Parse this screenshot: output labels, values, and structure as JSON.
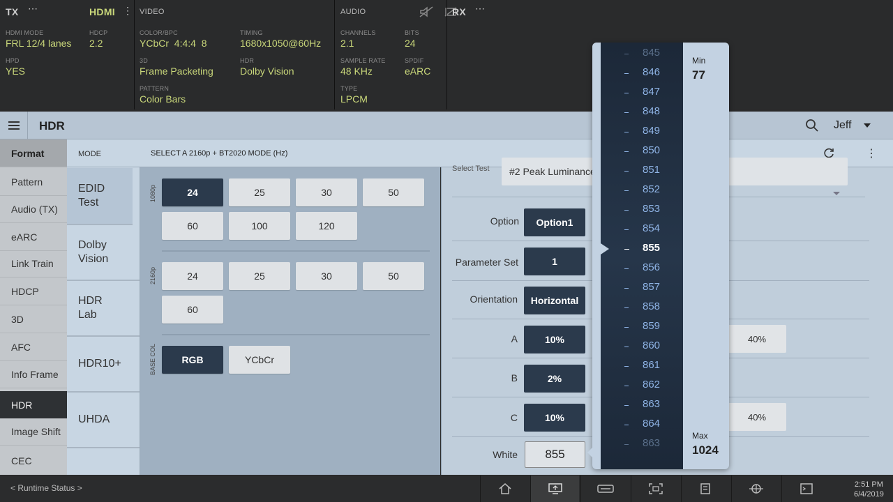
{
  "status": {
    "tx": {
      "title": "TX",
      "mode": "HDMI"
    },
    "video_title": "VIDEO",
    "audio_title": "AUDIO",
    "rx_title": "RX",
    "fields": {
      "hdmi_mode": {
        "label": "HDMI MODE",
        "value": "FRL 12/4 lanes"
      },
      "hdcp": {
        "label": "HDCP",
        "value": "2.2"
      },
      "hpd": {
        "label": "HPD",
        "value": "YES"
      },
      "color_bpc": {
        "label": "COLOR/BPC",
        "value": "YCbCr  4:4:4  8"
      },
      "timing": {
        "label": "TIMING",
        "value": "1680x1050@60Hz"
      },
      "threed": {
        "label": "3D",
        "value": "Frame Packeting"
      },
      "hdr": {
        "label": "HDR",
        "value": "Dolby Vision"
      },
      "pattern": {
        "label": "PATTERN",
        "value": "Color Bars"
      },
      "channels": {
        "label": "CHANNELS",
        "value": "2.1"
      },
      "bits": {
        "label": "BITS",
        "value": "24"
      },
      "sample_rate": {
        "label": "SAMPLE RATE",
        "value": "48 KHz"
      },
      "spdif": {
        "label": "SPDIF",
        "value": "eARC"
      },
      "type": {
        "label": "TYPE",
        "value": "LPCM"
      }
    }
  },
  "header": {
    "title": "HDR",
    "user": "Jeff"
  },
  "sidenav": [
    "Format",
    "Pattern",
    "Audio (TX)",
    "eARC",
    "Link Train",
    "HDCP",
    "3D",
    "AFC",
    "Info Frame",
    "HDR",
    "Image Shift",
    "CEC"
  ],
  "mode": {
    "header": "MODE",
    "items": [
      "EDID Test",
      "Dolby Vision",
      "HDR Lab",
      "HDR10+",
      "UHDA"
    ]
  },
  "middle": {
    "header": "SELECT A 2160p + BT2020 MODE (Hz)",
    "row1080_label": "1080p",
    "row2160_label": "2160p",
    "base_label": "BASE COL",
    "r1080": [
      "24",
      "25",
      "30",
      "50",
      "60",
      "100",
      "120"
    ],
    "r2160": [
      "24",
      "25",
      "30",
      "50",
      "60"
    ],
    "base": [
      "RGB",
      "YCbCr"
    ]
  },
  "right": {
    "select_test_label": "Select Test",
    "select_test_value": "#2 Peak Luminance",
    "option_label": "Option",
    "option_value": "Option1",
    "param_label": "Parameter Set",
    "param_value": "1",
    "orient_label": "Orientation",
    "orient_value": "Horizontal",
    "a_label": "A",
    "a_value": "10%",
    "a_alt": "40%",
    "b_label": "B",
    "b_value": "2%",
    "c_label": "C",
    "c_value": "10%",
    "c_alt": "40%",
    "white_label": "White",
    "white_value": "855"
  },
  "picker": {
    "values": [
      "845",
      "846",
      "847",
      "848",
      "849",
      "850",
      "851",
      "852",
      "853",
      "854",
      "855",
      "856",
      "857",
      "858",
      "859",
      "860",
      "861",
      "862",
      "863",
      "864",
      "863"
    ],
    "current": "855",
    "min_label": "Min",
    "min_value": "77",
    "max_label": "Max",
    "max_value": "1024"
  },
  "footer": {
    "runtime": "< Runtime Status >",
    "time": "2:51 PM",
    "date": "6/4/2019"
  },
  "icons": {
    "search": "search-icon",
    "refresh": "refresh-icon",
    "more": "more-vert-icon"
  }
}
